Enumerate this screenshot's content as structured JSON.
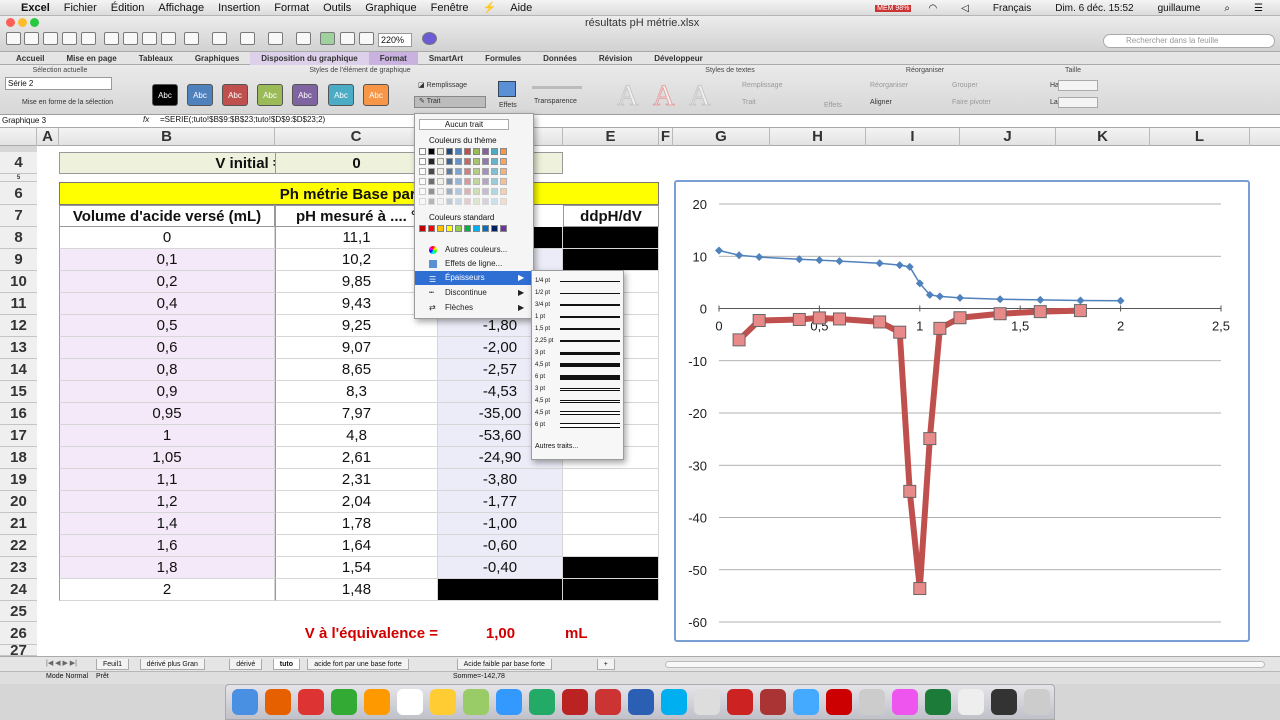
{
  "menubar": {
    "apple": "",
    "items": [
      "Excel",
      "Fichier",
      "Édition",
      "Affichage",
      "Insertion",
      "Format",
      "Outils",
      "Graphique",
      "Fenêtre",
      "⚡",
      "Aide"
    ],
    "right": {
      "battery_label": "MEM 98%",
      "language": "Français",
      "clock": "Dim. 6 déc. 15:52",
      "user": "guillaume"
    }
  },
  "window": {
    "title": "résultats pH métrie.xlsx",
    "zoom": "220%",
    "search_placeholder": "Rechercher dans la feuille"
  },
  "tabs": [
    "Accueil",
    "Mise en page",
    "Tableaux",
    "Graphiques",
    "Disposition du graphique",
    "Format",
    "SmartArt",
    "Formules",
    "Données",
    "Révision",
    "Développeur"
  ],
  "ribbon": {
    "groups": {
      "current_selection": "Sélection actuelle",
      "element_styles": "Styles de l'élément de graphique",
      "text_styles": "Styles de textes",
      "arrange": "Réorganiser",
      "size": "Taille"
    },
    "series_select": "Série 2",
    "format_selection": "Mise en forme de la sélection",
    "abc_label": "Abc",
    "abc_colors": [
      "#000000",
      "#4f81bd",
      "#c0504d",
      "#9bbb59",
      "#8064a2",
      "#4bacc6",
      "#f79646"
    ],
    "fill": "Remplissage",
    "line": "Trait",
    "effects": "Effets",
    "transparency": "Transparence",
    "text_fill": "Remplissage",
    "text_line": "Trait",
    "text_effects": "Effets",
    "reorganize": "Réorganiser",
    "align": "Aligner",
    "group": "Grouper",
    "rotate": "Faire pivoter",
    "height_label": "Hauteur :",
    "width_label": "Largeur :"
  },
  "formula": {
    "name_box": "Graphique 3",
    "fx": "fx",
    "content": "=SERIE(;tuto!$B$9:$B$23;tuto!$D$9:$D$23;2)"
  },
  "columns": [
    "A",
    "B",
    "C",
    "D",
    "E",
    "F",
    "G",
    "H",
    "I",
    "J",
    "K",
    "L"
  ],
  "rows": [
    "4",
    "5",
    "6",
    "7",
    "8",
    "9",
    "10",
    "11",
    "12",
    "13",
    "14",
    "15",
    "16",
    "17",
    "18",
    "19",
    "20",
    "21",
    "22",
    "23",
    "24",
    "25",
    "26",
    "27"
  ],
  "sheet": {
    "v_initial_label": "V initial =",
    "v_initial_value": "0",
    "title_row": "Ph métrie Base par un",
    "header_b": "Volume d'acide versé (mL)",
    "header_c": "pH mesuré à .... °",
    "header_e": "ddpH/dV",
    "volumes": [
      "0",
      "0,1",
      "0,2",
      "0,4",
      "0,5",
      "0,6",
      "0,8",
      "0,9",
      "0,95",
      "1",
      "1,05",
      "1,1",
      "1,2",
      "1,4",
      "1,6",
      "1,8",
      "2"
    ],
    "ph": [
      "11,1",
      "10,2",
      "9,85",
      "9,43",
      "9,25",
      "9,07",
      "8,65",
      "8,3",
      "7,97",
      "4,8",
      "2,61",
      "2,31",
      "2,04",
      "1,78",
      "1,64",
      "1,54",
      "1,48"
    ],
    "derivee": [
      "",
      "",
      "",
      "",
      "-1,80",
      "-2,00",
      "-2,57",
      "-4,53",
      "-35,00",
      "-53,60",
      "-24,90",
      "-3,80",
      "-1,77",
      "-1,00",
      "-0,60",
      "-0,40",
      ""
    ],
    "equiv_label": "V à l'équivalence =",
    "equiv_value": "1,00",
    "equiv_unit": "mL"
  },
  "dropdown": {
    "none": "Aucun trait",
    "theme_colors": "Couleurs du thème",
    "standard_colors": "Couleurs standard",
    "more_colors": "Autres couleurs...",
    "line_effects": "Effets de ligne...",
    "weights": "Épaisseurs",
    "dashes": "Discontinue",
    "arrows": "Flèches",
    "theme_row": [
      "#ffffff",
      "#000000",
      "#eeece1",
      "#1f497d",
      "#4f81bd",
      "#c0504d",
      "#9bbb59",
      "#8064a2",
      "#4bacc6",
      "#f79646"
    ],
    "standard_row": [
      "#c00000",
      "#ff0000",
      "#ffc000",
      "#ffff00",
      "#92d050",
      "#00b050",
      "#00b0f0",
      "#0070c0",
      "#002060",
      "#7030a0"
    ]
  },
  "weights_menu": {
    "items": [
      "1/4 pt",
      "1/2 pt",
      "3/4 pt",
      "1 pt",
      "1,5 pt",
      "2,25 pt",
      "3 pt",
      "4,5 pt",
      "6 pt",
      "3 pt",
      "4,5 pt",
      "4,5 pt",
      "6 pt"
    ],
    "more": "Autres traits..."
  },
  "sheet_tabs": [
    "Feuil1",
    "dérivé plus Gran",
    "dérivé",
    "tuto",
    "acide fort par une base forte",
    "Acide faible par base forte",
    "+"
  ],
  "active_tab": "tuto",
  "status": {
    "mode": "Mode Normal",
    "ready": "Prêt",
    "sum": "Somme=-142,78"
  },
  "chart_data": {
    "type": "line",
    "x": [
      0,
      0.1,
      0.2,
      0.4,
      0.5,
      0.6,
      0.8,
      0.9,
      0.95,
      1,
      1.05,
      1.1,
      1.2,
      1.4,
      1.6,
      1.8,
      2
    ],
    "series": [
      {
        "values": [
          11.1,
          10.2,
          9.85,
          9.43,
          9.25,
          9.07,
          8.65,
          8.3,
          7.97,
          4.8,
          2.61,
          2.31,
          2.04,
          1.78,
          1.64,
          1.54,
          1.48
        ],
        "color": "#4f81bd"
      },
      {
        "x": [
          0.1,
          0.2,
          0.4,
          0.5,
          0.6,
          0.8,
          0.9,
          0.95,
          1,
          1.05,
          1.1,
          1.2,
          1.4,
          1.6,
          1.8
        ],
        "values": [
          -6,
          -2.3,
          -2.1,
          -1.8,
          -2.0,
          -2.57,
          -4.53,
          -35,
          -53.6,
          -24.9,
          -3.8,
          -1.77,
          -1.0,
          -0.6,
          -0.4
        ],
        "color": "#c0504d"
      }
    ],
    "xlim": [
      0,
      2.5
    ],
    "ylim": [
      -60,
      20
    ],
    "xticks": [
      "0",
      "0,5",
      "1",
      "1,5",
      "2",
      "2,5"
    ],
    "yticks": [
      "20",
      "10",
      "0",
      "-10",
      "-20",
      "-30",
      "-40",
      "-50",
      "-60"
    ],
    "grid": true
  },
  "dock": {
    "apps": [
      "Finder",
      "Firefox",
      "Calendar",
      "Chrome",
      "VLC",
      "Calendrier",
      "Notes",
      "Photos",
      "App Store",
      "CDisplay",
      "FileZilla",
      "CrossOver",
      "Word",
      "Skype",
      "TextEdit",
      "Parallels",
      "Photo Booth",
      "Messages",
      "Acrobat",
      "Preview",
      "iTunes",
      "Excel",
      "Documents",
      "Terminal",
      "Corbeille"
    ]
  }
}
